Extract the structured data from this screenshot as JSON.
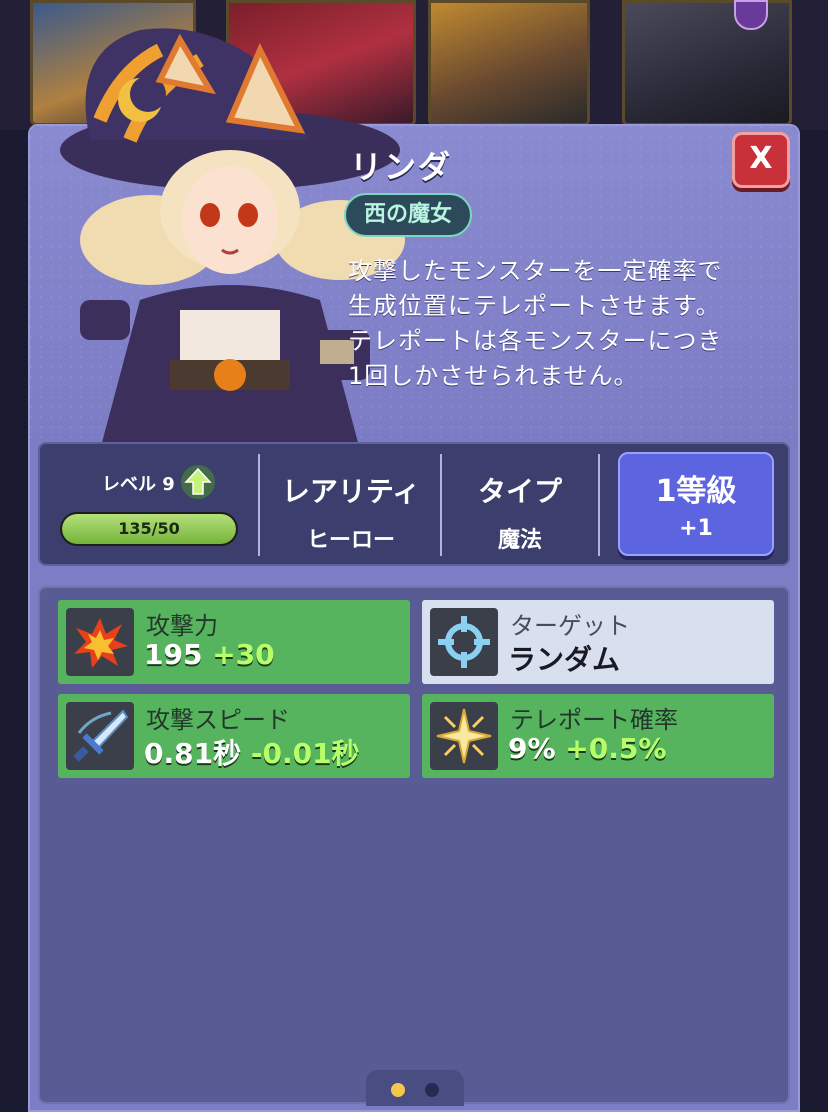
{
  "hero": {
    "name": "リンダ",
    "title": "西の魔女",
    "description": [
      "攻撃したモンスターを一定確率で",
      "生成位置にテレポートさせます。",
      "テレポートは各モンスターにつき",
      "1回しかさせられません。"
    ]
  },
  "info": {
    "level_label": "レベル 9",
    "exp_text": "135/50",
    "exp_fill_fraction": 1.0,
    "rarity_header": "レアリティ",
    "rarity_value": "ヒーロー",
    "type_header": "タイプ",
    "type_value": "魔法",
    "grade_header": "1等級",
    "grade_value": "+1"
  },
  "close_label": "X",
  "stats": [
    {
      "name": "攻撃力",
      "base": "195",
      "bonus": "+30",
      "icon": "explosion-icon",
      "style": "green"
    },
    {
      "name": "ターゲット",
      "base": "ランダム",
      "bonus": "",
      "icon": "crosshair-icon",
      "style": "light"
    },
    {
      "name": "攻撃スピード",
      "base": "0.81秒",
      "bonus": "-0.01秒",
      "icon": "sword-icon",
      "style": "green"
    },
    {
      "name": "テレポート確率",
      "base": "9%",
      "bonus": "+0.5%",
      "icon": "sparkle-icon",
      "style": "green"
    }
  ],
  "pager": {
    "pages": 2,
    "current": 1
  },
  "colors": {
    "panel": "#7d7dc6",
    "stat_green": "#56b45e",
    "stat_light": "#d8dfef",
    "grade_button": "#5d64e0",
    "close_button": "#c9313a"
  }
}
